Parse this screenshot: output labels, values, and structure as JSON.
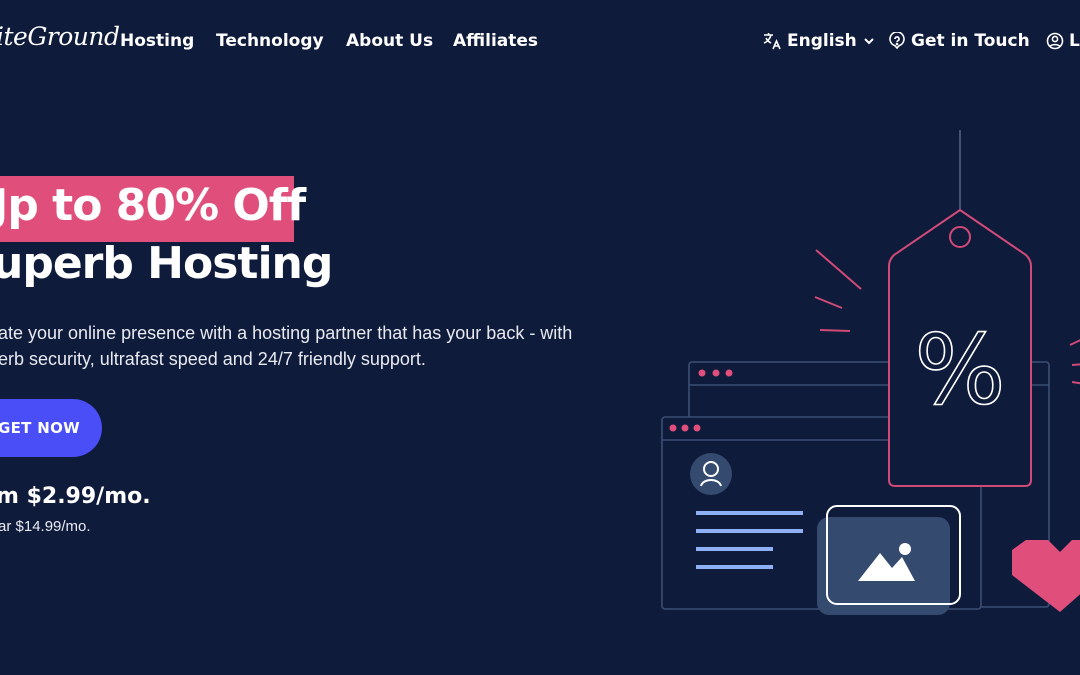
{
  "nav": {
    "logo": "iteGround",
    "items": [
      {
        "label": "Hosting"
      },
      {
        "label": "Technology"
      },
      {
        "label": "About Us"
      },
      {
        "label": "Affiliates"
      }
    ],
    "language": {
      "label": "English",
      "icon": "translate-icon"
    },
    "contact": {
      "label": "Get in Touch",
      "icon": "help-bubble-icon"
    },
    "login": {
      "label": "Lo",
      "icon": "user-circle-icon"
    }
  },
  "hero": {
    "promo": "Jp to 80% Off",
    "headline": "uperb Hosting",
    "description": "ate your online presence with a hosting partner that has your back - with erb security, ultrafast speed and 24/7 friendly support.",
    "cta_label": "GET NOW",
    "price": "m $2.99/mo.",
    "regular_price": "ar $14.99/mo."
  },
  "illustration": {
    "tag_symbol": "%",
    "icons": [
      "price-tag-icon",
      "browser-window-icon",
      "user-avatar-icon",
      "image-icon",
      "heart-icon"
    ]
  },
  "colors": {
    "background": "#0f1b3a",
    "accent_pink": "#e04e7b",
    "cta_blue": "#4a4ef7",
    "line_blue": "#8fb0f5"
  }
}
